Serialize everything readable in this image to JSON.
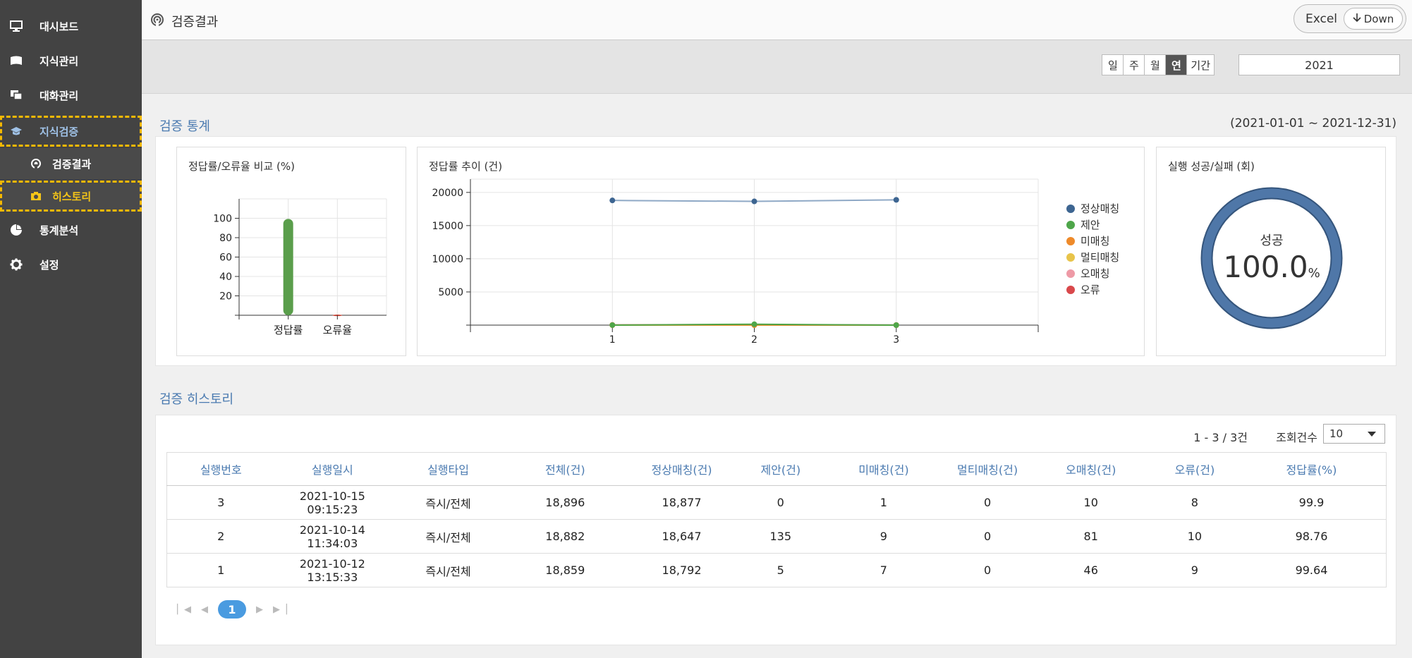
{
  "sidebar": {
    "items": [
      {
        "label": "대시보드",
        "icon": "monitor-icon"
      },
      {
        "label": "지식관리",
        "icon": "book-icon"
      },
      {
        "label": "대화관리",
        "icon": "chat-icon"
      },
      {
        "label": "지식검증",
        "icon": "graduation-cap-icon"
      },
      {
        "label": "검증결과",
        "icon": "broadcast-icon"
      },
      {
        "label": "히스토리",
        "icon": "camera-icon"
      },
      {
        "label": "통계분석",
        "icon": "pie-chart-icon"
      },
      {
        "label": "설정",
        "icon": "gear-icon"
      }
    ]
  },
  "header": {
    "title": "검증결과",
    "excel_label": "Excel",
    "down_label": "Down"
  },
  "filter": {
    "periods": [
      "일",
      "주",
      "월",
      "연",
      "기간"
    ],
    "active_period": "연",
    "year": "2021"
  },
  "stats": {
    "section_title": "검증 통계",
    "date_range": "(2021-01-01 ~ 2021-12-31)",
    "card1_title": "정답률/오류율 비교 (%)",
    "card2_title": "정답률 추이 (건)",
    "card3_title": "실행 성공/실패 (회)",
    "donut_label": "성공",
    "donut_value": "100.0",
    "donut_unit": "%"
  },
  "chart_data": [
    {
      "type": "bar",
      "title": "정답률/오류율 비교 (%)",
      "categories": [
        "정답률",
        "오류율"
      ],
      "values": [
        99.4,
        0.6
      ],
      "y_ticks": [
        "20",
        "40",
        "60",
        "80",
        "100"
      ],
      "ylim": [
        0,
        120
      ],
      "colors": [
        "#5a9e4b",
        "#c0392b"
      ],
      "grid": true
    },
    {
      "type": "line",
      "title": "정답률 추이 (건)",
      "x": [
        "1",
        "2",
        "3"
      ],
      "y_ticks": [
        "5000",
        "10000",
        "15000",
        "20000"
      ],
      "ylim": [
        0,
        22000
      ],
      "grid": true,
      "legend_position": "right",
      "series": [
        {
          "name": "정상매칭",
          "color": "#3d6591",
          "values": [
            18792,
            18647,
            18877
          ]
        },
        {
          "name": "제안",
          "color": "#4ea64a",
          "values": [
            5,
            135,
            0
          ]
        },
        {
          "name": "미매칭",
          "color": "#ee8a2a",
          "values": [
            7,
            9,
            1
          ]
        },
        {
          "name": "멀티매칭",
          "color": "#e8c44a",
          "values": [
            0,
            0,
            0
          ]
        },
        {
          "name": "오매칭",
          "color": "#ee9aa6",
          "values": [
            46,
            81,
            10
          ]
        },
        {
          "name": "오류",
          "color": "#d9484b",
          "values": [
            9,
            10,
            8
          ]
        }
      ]
    },
    {
      "type": "pie",
      "title": "실행 성공/실패 (회)",
      "categories": [
        "성공"
      ],
      "values": [
        100.0
      ],
      "colors": [
        "#4f77a8"
      ]
    }
  ],
  "history": {
    "section_title": "검증 히스토리",
    "page_info": "1 - 3 / 3건",
    "count_label": "조회건수",
    "count_value": "10",
    "columns": [
      "실행번호",
      "실행일시",
      "실행타입",
      "전체(건)",
      "정상매칭(건)",
      "제안(건)",
      "미매칭(건)",
      "멀티매칭(건)",
      "오매칭(건)",
      "오류(건)",
      "정답률(%)"
    ],
    "rows": [
      [
        "3",
        "2021-10-15 09:15:23",
        "즉시/전체",
        "18,896",
        "18,877",
        "0",
        "1",
        "0",
        "10",
        "8",
        "99.9"
      ],
      [
        "2",
        "2021-10-14 11:34:03",
        "즉시/전체",
        "18,882",
        "18,647",
        "135",
        "9",
        "0",
        "81",
        "10",
        "98.76"
      ],
      [
        "1",
        "2021-10-12 13:15:33",
        "즉시/전체",
        "18,859",
        "18,792",
        "5",
        "7",
        "0",
        "46",
        "9",
        "99.64"
      ]
    ],
    "current_page": "1"
  }
}
